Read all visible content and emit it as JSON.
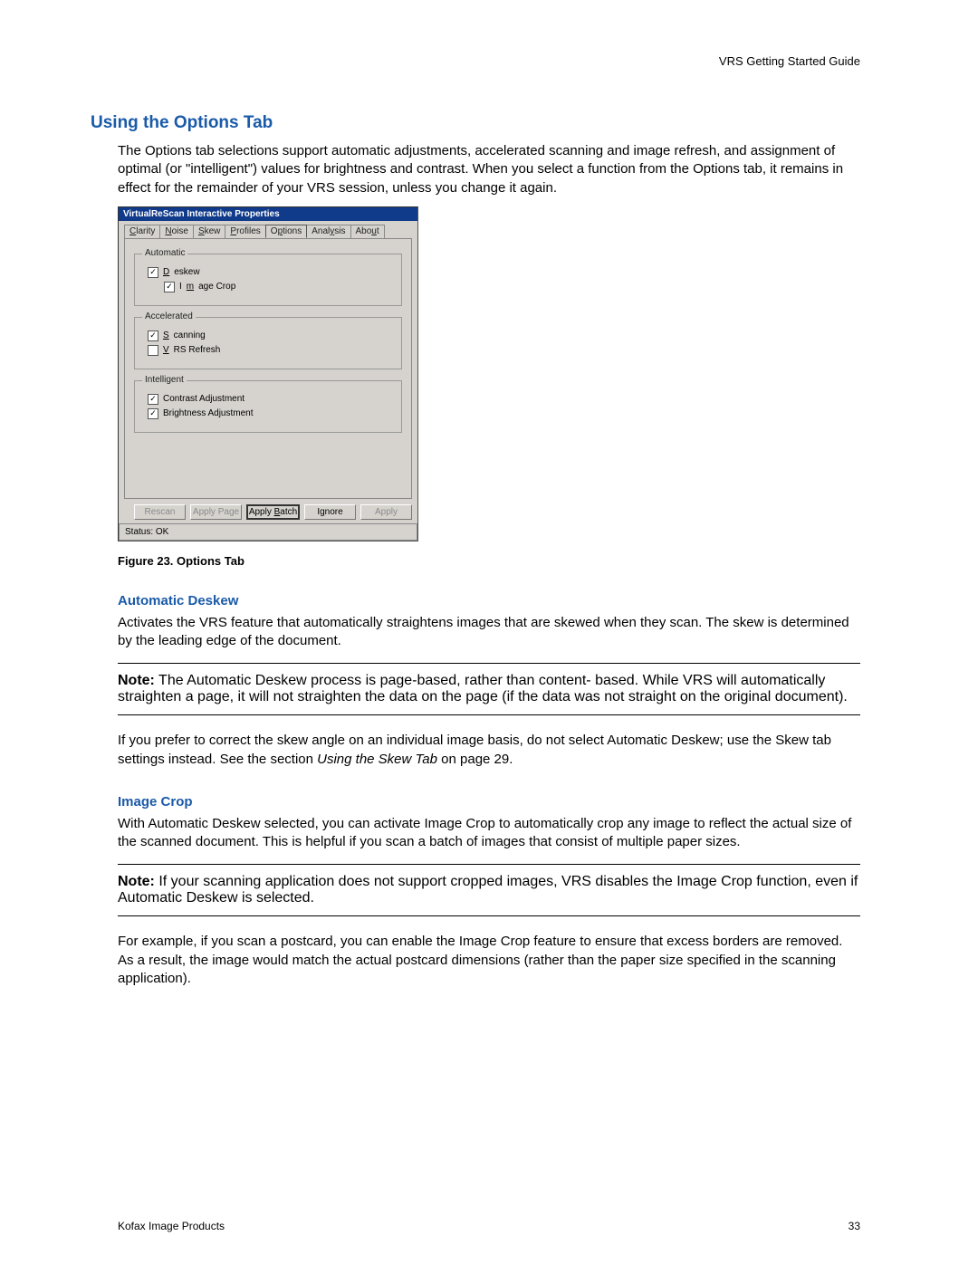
{
  "header": {
    "doc_title": "VRS Getting Started Guide"
  },
  "section": {
    "title": "Using the Options Tab",
    "intro": "The Options tab selections support automatic adjustments, accelerated scanning and image refresh, and assignment of optimal (or \"intelligent\") values for brightness and contrast. When you select a function from the Options tab, it remains in effect for the remainder of your VRS session, unless you change it again."
  },
  "dialog": {
    "title": "VirtualReScan Interactive Properties",
    "tabs": [
      "Clarity",
      "Noise",
      "Skew",
      "Profiles",
      "Options",
      "Analysis",
      "About"
    ],
    "selected_tab": "Options",
    "groups": {
      "automatic": {
        "label": "Automatic",
        "deskew": "Deskew",
        "image_crop": "Image Crop"
      },
      "accelerated": {
        "label": "Accelerated",
        "scanning": "Scanning",
        "vrs_refresh": "VRS Refresh"
      },
      "intelligent": {
        "label": "Intelligent",
        "contrast": "Contrast Adjustment",
        "brightness": "Brightness Adjustment"
      }
    },
    "buttons": {
      "rescan": "Rescan",
      "apply_page": "Apply Page",
      "apply_batch": "Apply Batch",
      "ignore": "Ignore",
      "apply": "Apply"
    },
    "status": "Status: OK"
  },
  "figure": {
    "caption": "Figure 23.  Options Tab"
  },
  "auto_deskew": {
    "heading": "Automatic Deskew",
    "p1": "Activates the VRS feature that automatically straightens images that are skewed when they scan. The skew is determined by the leading edge of the document.",
    "note_label": "Note:",
    "note": "  The Automatic Deskew process is page-based, rather than content- based. While VRS will automatically straighten a page, it will not straighten the data on the page (if the data was not straight on the original document).",
    "p2a": "If you prefer to correct the skew angle on an individual image basis, do not select Automatic Deskew; use the Skew tab settings instead. See the section ",
    "p2_ref": "Using the Skew Tab",
    "p2b": " on page 29."
  },
  "image_crop": {
    "heading": "Image Crop",
    "p1": "With Automatic Deskew selected, you can activate Image Crop to automatically crop any image to reflect the actual size of the scanned document. This is helpful if you scan a batch of images that consist of multiple paper sizes.",
    "note_label": "Note:",
    "note": "  If your scanning application does not support cropped images, VRS disables the Image Crop function, even if Automatic Deskew is selected.",
    "p2": "For example, if you scan a postcard, you can enable the Image Crop feature to ensure that excess borders are removed. As a result, the image would match the actual postcard dimensions (rather than the paper size specified in the scanning application)."
  },
  "footer": {
    "left": "Kofax Image Products",
    "page": "33"
  }
}
